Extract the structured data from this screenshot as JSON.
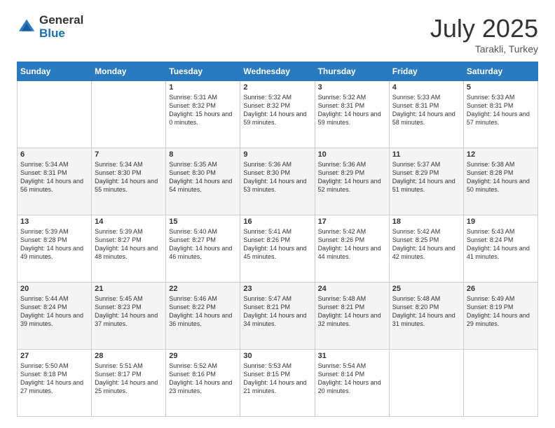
{
  "logo": {
    "general": "General",
    "blue": "Blue"
  },
  "title": {
    "month_year": "July 2025",
    "location": "Tarakli, Turkey"
  },
  "days_of_week": [
    "Sunday",
    "Monday",
    "Tuesday",
    "Wednesday",
    "Thursday",
    "Friday",
    "Saturday"
  ],
  "weeks": [
    [
      {
        "day": "",
        "info": ""
      },
      {
        "day": "",
        "info": ""
      },
      {
        "day": "1",
        "info": "Sunrise: 5:31 AM\nSunset: 8:32 PM\nDaylight: 15 hours and 0 minutes."
      },
      {
        "day": "2",
        "info": "Sunrise: 5:32 AM\nSunset: 8:32 PM\nDaylight: 14 hours and 59 minutes."
      },
      {
        "day": "3",
        "info": "Sunrise: 5:32 AM\nSunset: 8:31 PM\nDaylight: 14 hours and 59 minutes."
      },
      {
        "day": "4",
        "info": "Sunrise: 5:33 AM\nSunset: 8:31 PM\nDaylight: 14 hours and 58 minutes."
      },
      {
        "day": "5",
        "info": "Sunrise: 5:33 AM\nSunset: 8:31 PM\nDaylight: 14 hours and 57 minutes."
      }
    ],
    [
      {
        "day": "6",
        "info": "Sunrise: 5:34 AM\nSunset: 8:31 PM\nDaylight: 14 hours and 56 minutes."
      },
      {
        "day": "7",
        "info": "Sunrise: 5:34 AM\nSunset: 8:30 PM\nDaylight: 14 hours and 55 minutes."
      },
      {
        "day": "8",
        "info": "Sunrise: 5:35 AM\nSunset: 8:30 PM\nDaylight: 14 hours and 54 minutes."
      },
      {
        "day": "9",
        "info": "Sunrise: 5:36 AM\nSunset: 8:30 PM\nDaylight: 14 hours and 53 minutes."
      },
      {
        "day": "10",
        "info": "Sunrise: 5:36 AM\nSunset: 8:29 PM\nDaylight: 14 hours and 52 minutes."
      },
      {
        "day": "11",
        "info": "Sunrise: 5:37 AM\nSunset: 8:29 PM\nDaylight: 14 hours and 51 minutes."
      },
      {
        "day": "12",
        "info": "Sunrise: 5:38 AM\nSunset: 8:28 PM\nDaylight: 14 hours and 50 minutes."
      }
    ],
    [
      {
        "day": "13",
        "info": "Sunrise: 5:39 AM\nSunset: 8:28 PM\nDaylight: 14 hours and 49 minutes."
      },
      {
        "day": "14",
        "info": "Sunrise: 5:39 AM\nSunset: 8:27 PM\nDaylight: 14 hours and 48 minutes."
      },
      {
        "day": "15",
        "info": "Sunrise: 5:40 AM\nSunset: 8:27 PM\nDaylight: 14 hours and 46 minutes."
      },
      {
        "day": "16",
        "info": "Sunrise: 5:41 AM\nSunset: 8:26 PM\nDaylight: 14 hours and 45 minutes."
      },
      {
        "day": "17",
        "info": "Sunrise: 5:42 AM\nSunset: 8:26 PM\nDaylight: 14 hours and 44 minutes."
      },
      {
        "day": "18",
        "info": "Sunrise: 5:42 AM\nSunset: 8:25 PM\nDaylight: 14 hours and 42 minutes."
      },
      {
        "day": "19",
        "info": "Sunrise: 5:43 AM\nSunset: 8:24 PM\nDaylight: 14 hours and 41 minutes."
      }
    ],
    [
      {
        "day": "20",
        "info": "Sunrise: 5:44 AM\nSunset: 8:24 PM\nDaylight: 14 hours and 39 minutes."
      },
      {
        "day": "21",
        "info": "Sunrise: 5:45 AM\nSunset: 8:23 PM\nDaylight: 14 hours and 37 minutes."
      },
      {
        "day": "22",
        "info": "Sunrise: 5:46 AM\nSunset: 8:22 PM\nDaylight: 14 hours and 36 minutes."
      },
      {
        "day": "23",
        "info": "Sunrise: 5:47 AM\nSunset: 8:21 PM\nDaylight: 14 hours and 34 minutes."
      },
      {
        "day": "24",
        "info": "Sunrise: 5:48 AM\nSunset: 8:21 PM\nDaylight: 14 hours and 32 minutes."
      },
      {
        "day": "25",
        "info": "Sunrise: 5:48 AM\nSunset: 8:20 PM\nDaylight: 14 hours and 31 minutes."
      },
      {
        "day": "26",
        "info": "Sunrise: 5:49 AM\nSunset: 8:19 PM\nDaylight: 14 hours and 29 minutes."
      }
    ],
    [
      {
        "day": "27",
        "info": "Sunrise: 5:50 AM\nSunset: 8:18 PM\nDaylight: 14 hours and 27 minutes."
      },
      {
        "day": "28",
        "info": "Sunrise: 5:51 AM\nSunset: 8:17 PM\nDaylight: 14 hours and 25 minutes."
      },
      {
        "day": "29",
        "info": "Sunrise: 5:52 AM\nSunset: 8:16 PM\nDaylight: 14 hours and 23 minutes."
      },
      {
        "day": "30",
        "info": "Sunrise: 5:53 AM\nSunset: 8:15 PM\nDaylight: 14 hours and 21 minutes."
      },
      {
        "day": "31",
        "info": "Sunrise: 5:54 AM\nSunset: 8:14 PM\nDaylight: 14 hours and 20 minutes."
      },
      {
        "day": "",
        "info": ""
      },
      {
        "day": "",
        "info": ""
      }
    ]
  ]
}
